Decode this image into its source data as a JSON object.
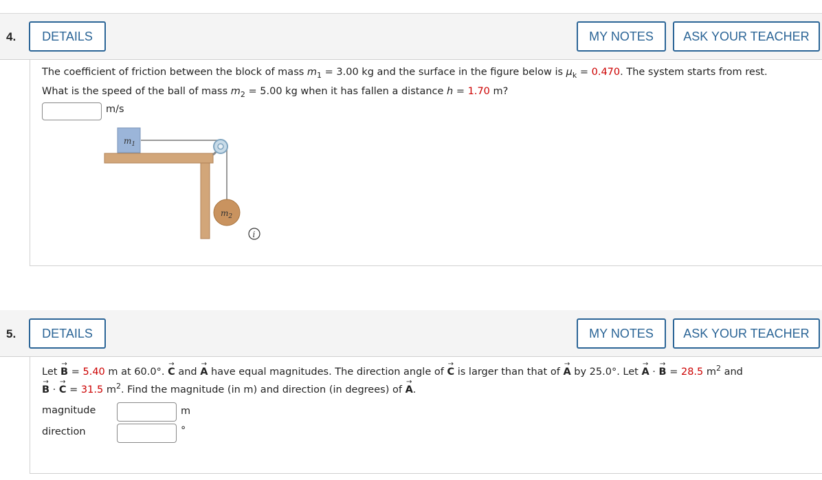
{
  "question4": {
    "number": "4.",
    "details_label": "DETAILS",
    "my_notes_label": "MY NOTES",
    "ask_teacher_label": "ASK YOUR TEACHER",
    "text": {
      "p1": "The coefficient of friction between the block of mass ",
      "m": "m",
      "sub1": "1",
      "p2": " = 3.00 kg and the surface in the figure below is ",
      "mu": "μ",
      "subk": "k",
      "p3": " = ",
      "mu_value": "0.470",
      "p4": ". The system starts from rest.",
      "l2a": "What is the speed of the ball of mass ",
      "sub2": "2",
      "l2b": " = 5.00 kg when it has fallen a distance ",
      "h": "h",
      "l2c": " = ",
      "h_value": "1.70",
      "l2d": " m?"
    },
    "answer_unit": "m/s",
    "figure": {
      "block_label": "m",
      "block_sub": "1",
      "ball_label": "m",
      "ball_sub": "2"
    },
    "colors": {
      "table": "#d2a679",
      "block": "#9bb5d9",
      "ball": "#c9935f",
      "accent": "#2a6496",
      "given": "#cc0000"
    },
    "info_icon": "info-icon"
  },
  "question5": {
    "number": "5.",
    "details_label": "DETAILS",
    "my_notes_label": "MY NOTES",
    "ask_teacher_label": "ASK YOUR TEACHER",
    "text": {
      "let": "Let ",
      "B": "B",
      "C": "C",
      "A": "A",
      "eq": " = ",
      "B_value": "5.40",
      "s1": " m at 60.0°. ",
      "s2": " and ",
      "s3": " have equal magnitudes. The direction angle of ",
      "s4": " is larger than that of ",
      "s5": " by 25.0°. Let ",
      "dot": " · ",
      "AB_value": "28.5",
      "m2": " m",
      "sq": "2",
      "and": " and",
      "BC_value": "31.5",
      "s6": ". Find the magnitude (in m) and direction (in degrees) of ",
      "end": "."
    },
    "magnitude_label": "magnitude",
    "magnitude_unit": "m",
    "direction_label": "direction",
    "direction_unit": "°"
  }
}
